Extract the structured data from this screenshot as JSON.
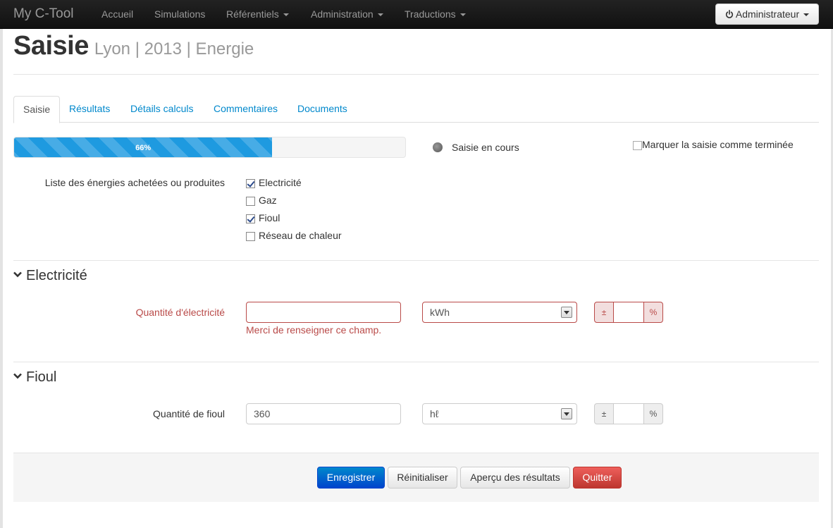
{
  "navbar": {
    "brand": "My C-Tool",
    "items": [
      {
        "label": "Accueil",
        "dropdown": false
      },
      {
        "label": "Simulations",
        "dropdown": false
      },
      {
        "label": "Référentiels",
        "dropdown": true
      },
      {
        "label": "Administration",
        "dropdown": true
      },
      {
        "label": "Traductions",
        "dropdown": true
      }
    ],
    "user_menu": {
      "label": "Administrateur",
      "icon": "power-icon"
    }
  },
  "header": {
    "title": "Saisie",
    "subtitle": "Lyon | 2013 | Energie"
  },
  "tabs": [
    {
      "label": "Saisie",
      "active": true
    },
    {
      "label": "Résultats",
      "active": false
    },
    {
      "label": "Détails calculs",
      "active": false
    },
    {
      "label": "Commentaires",
      "active": false
    },
    {
      "label": "Documents",
      "active": false
    }
  ],
  "progress": {
    "value_pct": 66,
    "label": "66%",
    "status_text": "Saisie en cours",
    "mark_done_label": "Marquer la saisie comme terminée",
    "mark_done_checked": false
  },
  "energies": {
    "label": "Liste des énergies achetées ou produites",
    "options": [
      {
        "label": "Electricité",
        "checked": true
      },
      {
        "label": "Gaz",
        "checked": false
      },
      {
        "label": "Fioul",
        "checked": true
      },
      {
        "label": "Réseau de chaleur",
        "checked": false
      }
    ]
  },
  "sections": {
    "electricite": {
      "title": "Electricité",
      "field_label": "Quantité d'électricité",
      "value": "",
      "unit": "kWh",
      "uncertainty_prefix": "±",
      "uncertainty_suffix": "%",
      "uncertainty_value": "",
      "error": "Merci de renseigner ce champ.",
      "error_color": "#b94a48"
    },
    "fioul": {
      "title": "Fioul",
      "field_label": "Quantité de fioul",
      "value": "360",
      "unit": "hℓ",
      "uncertainty_prefix": "±",
      "uncertainty_suffix": "%",
      "uncertainty_value": ""
    }
  },
  "actions": {
    "save": "Enregistrer",
    "reset": "Réinitialiser",
    "preview": "Aperçu des résultats",
    "quit": "Quitter"
  },
  "colors": {
    "navbar_bg": "#1b1b1b",
    "link": "#0088cc",
    "progress": "#1e9ae0",
    "primary": "#0055cc",
    "danger": "#da4f49"
  }
}
